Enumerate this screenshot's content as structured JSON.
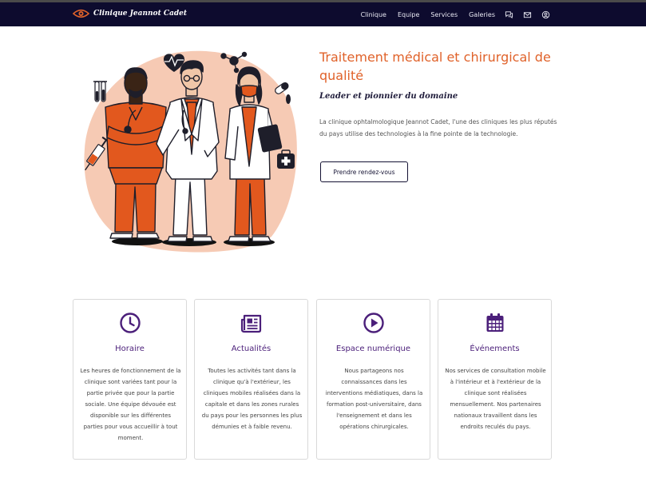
{
  "navbar": {
    "brand": "Clinique Jeannot Cadet",
    "logo_icon": "eye-logo-icon",
    "links": [
      "Clinique",
      "Equipe",
      "Services",
      "Galeries"
    ],
    "icons": [
      "chat-icon",
      "mail-icon",
      "user-circle-icon"
    ],
    "background_color": "#0d0b2e"
  },
  "hero": {
    "title": "Traitement médical et chirurgical de qualité",
    "subtitle": "Leader et pionnier du domaine",
    "description": "La clinique ophtalmologique Jeannot Cadet, l'une des cliniques les plus réputés du pays utilise des technologies à la fine pointe de la technologie.",
    "cta_label": "Prendre rendez-vous",
    "accent_color": "#e0622a"
  },
  "illustration": {
    "subject": "three medical staff illustration",
    "icons": [
      "heart-rate-icon",
      "molecule-icon",
      "test-tubes-icon",
      "pill-icon",
      "syringe-icon",
      "first-aid-kit-icon"
    ]
  },
  "cards": [
    {
      "icon": "clock-icon",
      "title": "Horaire",
      "text": "Les heures de fonctionnement de la clinique sont variées tant pour la partie privée que pour la partie sociale. Une équipe dévouée est disponible sur les différentes parties pour vous accueillir à tout moment."
    },
    {
      "icon": "newspaper-icon",
      "title": "Actualités",
      "text": "Toutes les activités tant dans la clinique qu'à l'extérieur, les cliniques mobiles réalisées dans la capitale et dans les zones rurales du pays pour les personnes les plus démunies et à faible revenu."
    },
    {
      "icon": "play-circle-icon",
      "title": "Espace numérique",
      "text": "Nous partageons nos connaissances dans les interventions médiatiques, dans la formation post-universitaire, dans l'enseignement et dans les opérations chirurgicales."
    },
    {
      "icon": "calendar-icon",
      "title": "Événements",
      "text": "Nos services de consultation mobile à l'intérieur et à l'extérieur de la clinique sont réalisées mensuellement. Nos partenaires nationaux travaillent dans les endroits reculés du pays."
    }
  ],
  "colors": {
    "card_title": "#4b1f7a",
    "card_icon": "#4b1f7a",
    "scrub_orange": "#e2581e",
    "blob_peach": "#f6cab4"
  }
}
